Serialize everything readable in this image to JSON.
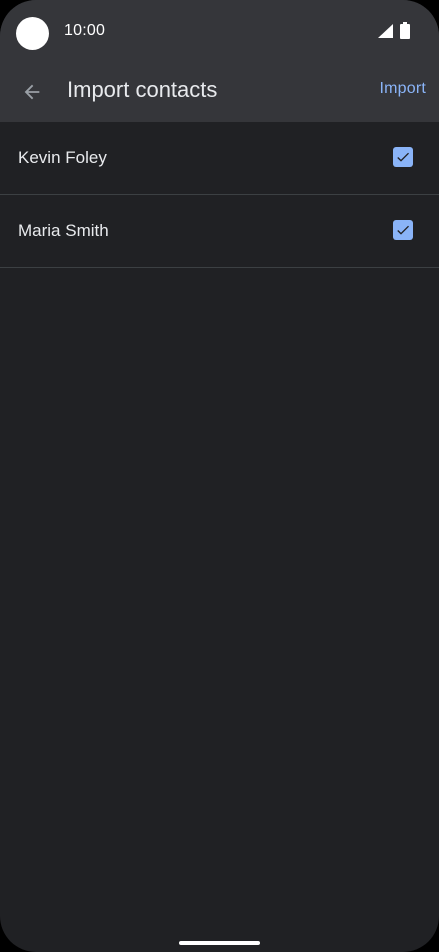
{
  "status_bar": {
    "time": "10:00",
    "icons": [
      "camera-cutout",
      "signal-icon",
      "battery-icon"
    ]
  },
  "app_bar": {
    "back_icon": "arrow-back-icon",
    "title": "Import contacts",
    "import_label": "Import"
  },
  "contacts": [
    {
      "name": "Kevin Foley",
      "checked": true
    },
    {
      "name": "Maria Smith",
      "checked": true
    }
  ],
  "colors": {
    "background": "#202124",
    "bar": "#35363a",
    "accent": "#8ab4f8",
    "divider": "#3c4043"
  }
}
